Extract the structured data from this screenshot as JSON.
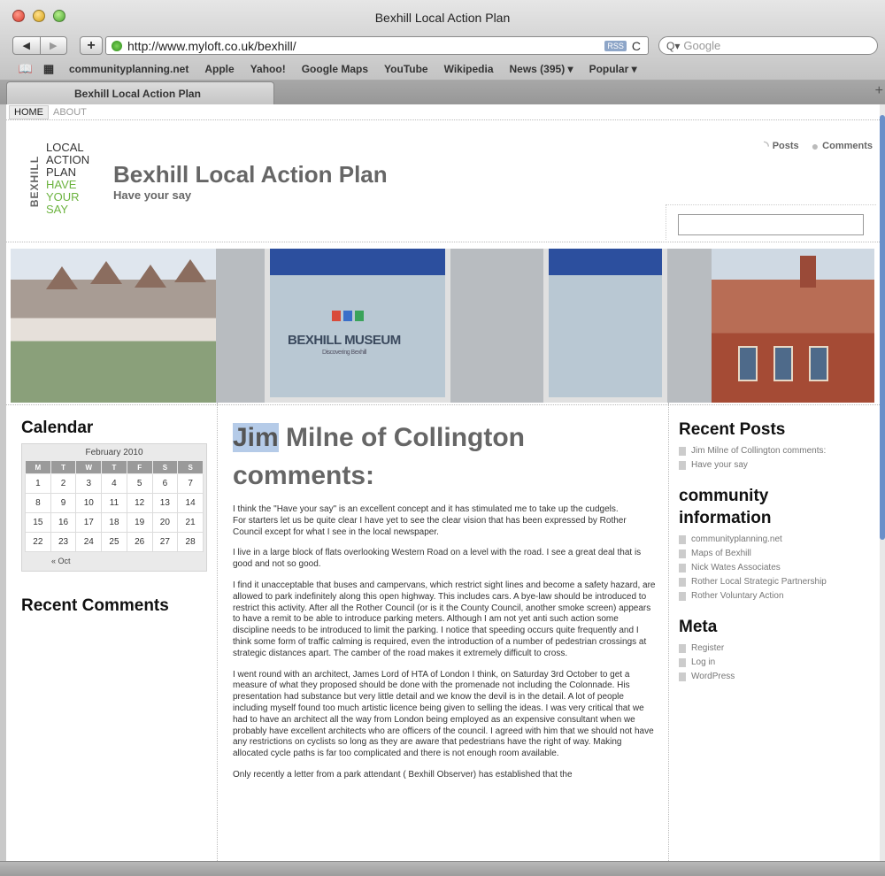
{
  "window": {
    "title": "Bexhill Local Action Plan"
  },
  "toolbar": {
    "back_glyph": "◀",
    "forward_glyph": "▶",
    "add_glyph": "+",
    "url": "http://www.myloft.co.uk/bexhill/",
    "rss_label": "RSS",
    "reload_glyph": "C",
    "search_placeholder": "Google",
    "search_glyph": "Q▾"
  },
  "bookmarks": {
    "book_icon": "📖",
    "grid_icon": "▦",
    "items": [
      "communityplanning.net",
      "Apple",
      "Yahoo!",
      "Google Maps",
      "YouTube",
      "Wikipedia",
      "News (395) ▾",
      "Popular ▾"
    ]
  },
  "tab": {
    "label": "Bexhill Local Action Plan",
    "plus": "+"
  },
  "topnav": {
    "home": "HOME",
    "about": "ABOUT"
  },
  "logo": {
    "vertical": "BEXHILL",
    "lines_dark": [
      "LOCAL",
      "ACTION",
      "PLAN"
    ],
    "lines_green": [
      "HAVE",
      "YOUR",
      "SAY"
    ]
  },
  "site": {
    "title": "Bexhill Local Action Plan",
    "tagline": "Have your say"
  },
  "feeds": {
    "posts": "Posts",
    "comments": "Comments",
    "posts_icon": "◝",
    "comments_icon": "●"
  },
  "banner": {
    "museum_name": "BEXHILL MUSEUM",
    "museum_sub": "Discovering Bexhill"
  },
  "calendar": {
    "title": "Calendar",
    "caption": "February 2010",
    "days": [
      "M",
      "T",
      "W",
      "T",
      "F",
      "S",
      "S"
    ],
    "weeks": [
      [
        "1",
        "2",
        "3",
        "4",
        "5",
        "6",
        "7"
      ],
      [
        "8",
        "9",
        "10",
        "11",
        "12",
        "13",
        "14"
      ],
      [
        "15",
        "16",
        "17",
        "18",
        "19",
        "20",
        "21"
      ],
      [
        "22",
        "23",
        "24",
        "25",
        "26",
        "27",
        "28"
      ]
    ],
    "prev": "« Oct"
  },
  "recent_comments": {
    "title": "Recent Comments"
  },
  "post": {
    "title_highlight": "Jim",
    "title_rest": " Milne of Collington comments:",
    "paragraphs": [
      "I think the \"Have your say\" is an excellent concept and it has stimulated me to take up the cudgels.\nFor starters let us be quite clear I have yet to see the clear vision that has been expressed by Rother Council except for what I see in the local newspaper.",
      "I live in a large block of flats overlooking Western Road on a level with the road. I see a great deal that is good and not so good.",
      "I find it unacceptable that buses and campervans, which restrict sight lines and become a safety hazard, are allowed to park indefinitely along this open highway. This includes cars. A bye-law should be introduced to restrict this activity. After all the Rother Council (or is it the County Council, another smoke screen) appears to have a remit to be able to introduce parking meters. Although I am not yet anti such action some discipline needs to be introduced to limit the parking. I notice that speeding occurs quite frequently and I think some form of traffic calming is required, even the introduction of a number of pedestrian crossings at strategic distances apart. The camber of the road makes it extremely difficult to cross.",
      "I went round with an architect, James Lord of HTA of London I think, on Saturday 3rd October to get a measure of what they proposed should be done with the promenade not including the Colonnade. His presentation had substance but very little detail and we know the devil is in the detail. A lot of people including myself found too much artistic licence being given to selling the ideas. I was very critical that we had to have an architect all the way from London being employed as an expensive consultant when we probably have excellent architects who are officers of the council. I agreed with him that we should not have any restrictions on cyclists so long as they are aware that pedestrians have the right of way. Making allocated cycle paths is far too complicated and there is not enough room available.",
      "Only recently a letter from a park attendant ( Bexhill Observer) has established that the"
    ]
  },
  "sidebar": {
    "recent_posts": {
      "title": "Recent Posts",
      "items": [
        "Jim Milne of Collington comments:",
        "Have your say"
      ]
    },
    "community": {
      "title_line1": "community",
      "title_line2": "information",
      "items": [
        "communityplanning.net",
        "Maps of Bexhill",
        "Nick Wates Associates",
        "Rother Local Strategic Partnership",
        "Rother Voluntary Action"
      ]
    },
    "meta": {
      "title": "Meta",
      "items": [
        "Register",
        "Log in",
        "WordPress"
      ]
    }
  },
  "colors": {
    "accent_green": "#6cb33f",
    "title_gray": "#666666",
    "selection_blue": "#b5cbe8"
  }
}
